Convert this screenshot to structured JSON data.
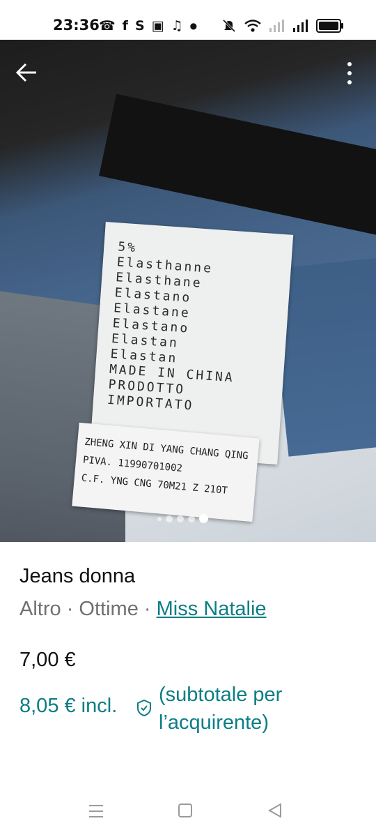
{
  "status_bar": {
    "time": "23:36",
    "notification_icons": [
      "whatsapp-icon",
      "facebook-icon",
      "s-app-icon",
      "instagram-icon",
      "tiktok-icon",
      "dot-icon"
    ],
    "right_icons": [
      "mute-icon",
      "wifi-icon",
      "signal-icon",
      "signal-icon",
      "battery-icon"
    ]
  },
  "photo": {
    "label_lines": [
      "5%",
      "Elasthanne",
      "Elasthane",
      "Elastano",
      "Elastane",
      "Elastano",
      "Elastan",
      "Elastan",
      "MADE IN CHINA",
      "PRODOTTO IMPORTATO"
    ],
    "small_label_lines": [
      "ZHENG XIN DI YANG CHANG QING",
      "PIVA. 11990701002",
      "C.F. YNG CNG 70M21 Z 210T"
    ],
    "image_count": 5,
    "active_index": 5
  },
  "product": {
    "title": "Jeans donna",
    "category": "Altro",
    "separator": " · ",
    "condition": "Ottime",
    "seller": "Miss Natalie",
    "price": "7,00 €",
    "total_price": "8,05 € incl.",
    "total_note": "(subtotale per l’acquirente)"
  },
  "colors": {
    "accent": "#0b7d85",
    "text_primary": "#111111",
    "text_secondary": "#707070"
  }
}
